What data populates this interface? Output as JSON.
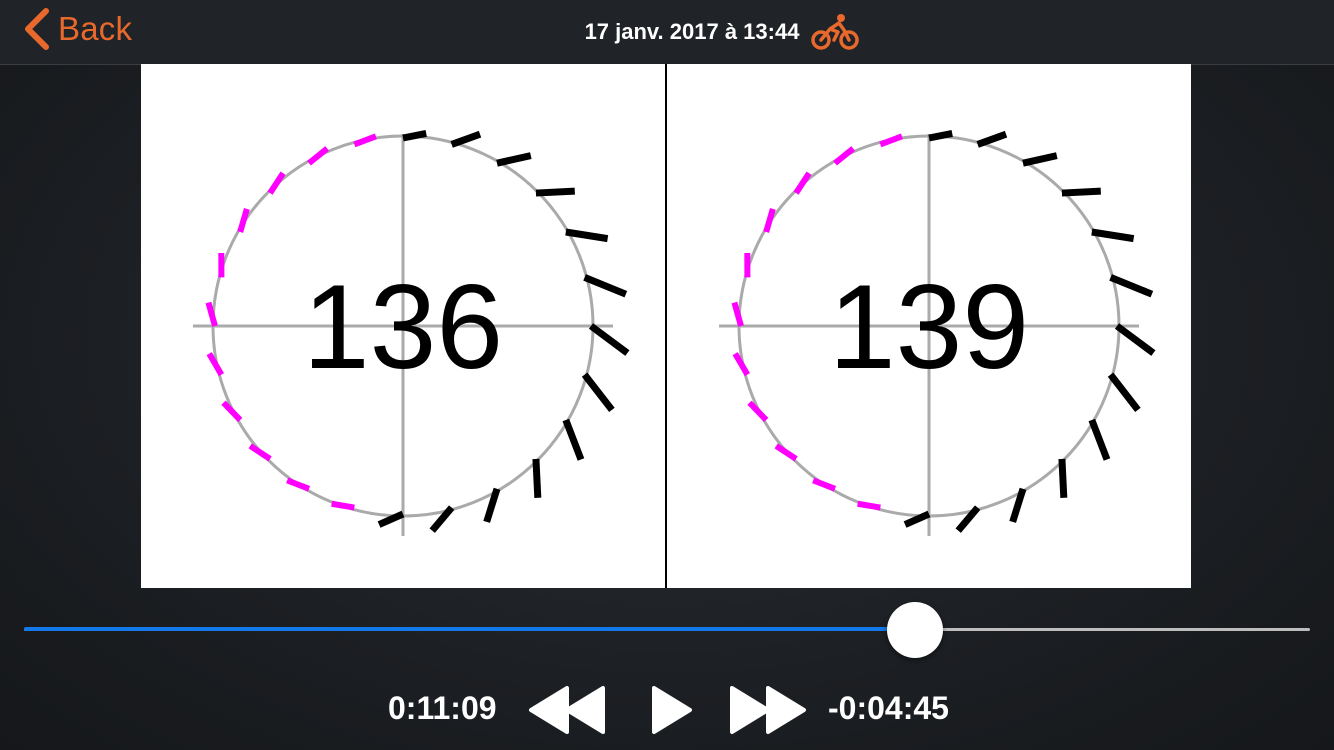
{
  "header": {
    "back_label": "Back",
    "title": "17 janv. 2017 à 13:44",
    "activity_icon": "bicycle-icon",
    "accent_color": "#e8692b"
  },
  "panels": [
    {
      "cadence": "136",
      "circle_color": "#aaaaaa",
      "push_color": "#000000",
      "pull_color": "#ff00ff"
    },
    {
      "cadence": "139",
      "circle_color": "#aaaaaa",
      "push_color": "#000000",
      "pull_color": "#ff00ff"
    }
  ],
  "playback": {
    "elapsed": "0:11:09",
    "remaining": "-0:04:45",
    "progress": 0.693,
    "progress_color": "#1578e8",
    "rewind_icon": "rewind-icon",
    "play_icon": "play-icon",
    "forward_icon": "fast-forward-icon"
  }
}
